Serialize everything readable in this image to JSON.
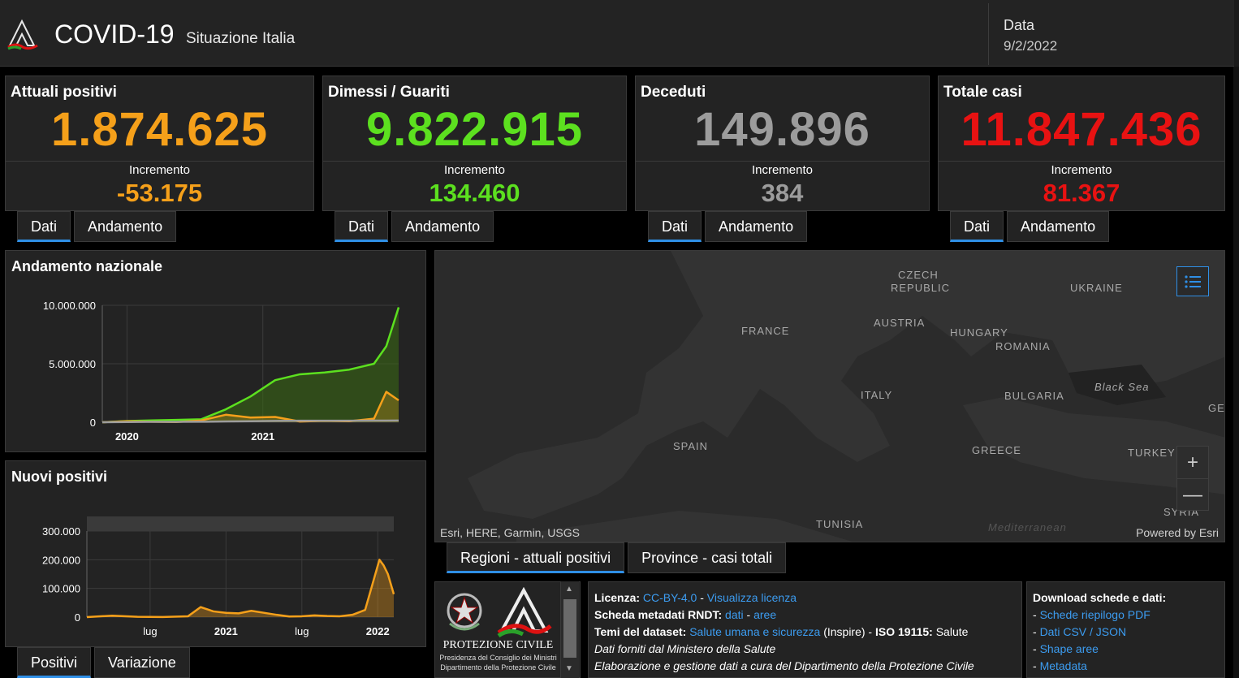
{
  "header": {
    "title": "COVID-19",
    "subtitle": "Situazione Italia",
    "date_label": "Data",
    "date_value": "9/2/2022"
  },
  "colors": {
    "orange": "#f5a01a",
    "green": "#5ce01f",
    "gray": "#9c9c9c",
    "red": "#e81212",
    "accent": "#2f8fe6",
    "link": "#3c9cf0"
  },
  "cards": [
    {
      "title": "Attuali positivi",
      "value": "1.874.625",
      "inc_label": "Incremento",
      "inc": "-53.175",
      "tabs": [
        "Dati",
        "Andamento"
      ]
    },
    {
      "title": "Dimessi / Guariti",
      "value": "9.822.915",
      "inc_label": "Incremento",
      "inc": "134.460",
      "tabs": [
        "Dati",
        "Andamento"
      ]
    },
    {
      "title": "Deceduti",
      "value": "149.896",
      "inc_label": "Incremento",
      "inc": "384",
      "tabs": [
        "Dati",
        "Andamento"
      ]
    },
    {
      "title": "Totale casi",
      "value": "11.847.436",
      "inc_label": "Incremento",
      "inc": "81.367",
      "tabs": [
        "Dati",
        "Andamento"
      ]
    }
  ],
  "chart_data": [
    {
      "type": "area",
      "title": "Andamento nazionale",
      "xlabel": "",
      "ylabel": "",
      "x_ticks": [
        "2020",
        "2021"
      ],
      "y_ticks": [
        "10.000.000",
        "5.000.000",
        "0"
      ],
      "ylim": [
        0,
        10000000
      ],
      "x": [
        "2020-02",
        "2020-04",
        "2020-06",
        "2020-08",
        "2020-10",
        "2020-12",
        "2021-02",
        "2021-04",
        "2021-06",
        "2021-08",
        "2021-10",
        "2021-12",
        "2022-01",
        "2022-02"
      ],
      "series": [
        {
          "values": [
            0,
            100000,
            160000,
            200000,
            250000,
            1100000,
            2200000,
            3600000,
            4100000,
            4250000,
            4500000,
            5000000,
            6500000,
            9822915
          ]
        },
        {
          "values": [
            0,
            90000,
            40000,
            20000,
            150000,
            640000,
            400000,
            450000,
            60000,
            120000,
            90000,
            300000,
            2600000,
            1874625
          ]
        },
        {
          "values": [
            0,
            20000,
            35000,
            35000,
            40000,
            70000,
            90000,
            115000,
            127000,
            128000,
            131000,
            136000,
            140000,
            149896
          ]
        }
      ]
    },
    {
      "type": "area",
      "title": "Nuovi positivi",
      "xlabel": "",
      "ylabel": "",
      "x_ticks": [
        "lug",
        "2021",
        "lug",
        "2022"
      ],
      "y_ticks": [
        "300.000",
        "200.000",
        "100.000",
        "0"
      ],
      "ylim": [
        0,
        300000
      ],
      "x": [
        "2020-02",
        "2020-04",
        "2020-06",
        "2020-08",
        "2020-10",
        "2020-11",
        "2020-12",
        "2021-01",
        "2021-02",
        "2021-03",
        "2021-04",
        "2021-05",
        "2021-06",
        "2021-07",
        "2021-08",
        "2021-09",
        "2021-10",
        "2021-11",
        "2021-12",
        "2022-01-05",
        "2022-01-15",
        "2022-01-25",
        "2022-02-09"
      ],
      "series": [
        {
          "values": [
            0,
            5000,
            1000,
            500,
            3000,
            35000,
            20000,
            15000,
            13000,
            22000,
            15000,
            8000,
            2000,
            3000,
            6000,
            4000,
            3000,
            8000,
            25000,
            200000,
            180000,
            150000,
            80000
          ]
        }
      ]
    }
  ],
  "chart_tabs": [
    "Positivi",
    "Variazione"
  ],
  "map": {
    "labels": [
      "CZECH",
      "REPUBLIC",
      "UKRAINE",
      "FRANCE",
      "AUSTRIA",
      "HUNGARY",
      "ROMANIA",
      "Black Sea",
      "ITALY",
      "BULGARIA",
      "GEO",
      "SPAIN",
      "GREECE",
      "TURKEY",
      "TUNISIA",
      "SYRIA",
      "Mediterranean"
    ],
    "attribution_left": "Esri, HERE, Garmin, USGS",
    "attribution_right": "Powered by Esri",
    "zoom_in": "+",
    "zoom_out": "—",
    "tabs": [
      "Regioni - attuali positivi",
      "Province - casi totali"
    ]
  },
  "logo": {
    "name": "PROTEZIONE CIVILE",
    "line1": "Presidenza del Consiglio dei Ministri",
    "line2": "Dipartimento della Protezione Civile"
  },
  "info": {
    "licenza_label": "Licenza:",
    "licenza_link": "CC-BY-4.0",
    "licenza_sep": " - ",
    "licenza_link2": "Visualizza licenza",
    "scheda_label": "Scheda metadati RNDT:",
    "scheda_link1": "dati",
    "scheda_sep": " - ",
    "scheda_link2": "aree",
    "temi_label": "Temi del dataset:",
    "temi_link": "Salute umana e sicurezza",
    "temi_suffix": " (Inspire) - ",
    "iso_label": "ISO 19115:",
    "iso_value": " Salute",
    "line4": "Dati forniti dal Ministero della Salute",
    "line5": "Elaborazione e gestione dati a cura del Dipartimento della Protezione Civile"
  },
  "downloads": {
    "title": "Download schede e dati:",
    "items": [
      "Schede riepilogo PDF",
      "Dati CSV / JSON",
      "Shape aree",
      "Metadata"
    ]
  }
}
